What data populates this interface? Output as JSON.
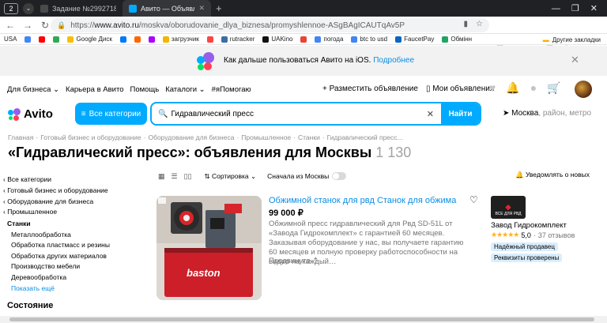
{
  "browser": {
    "tab_count": "2",
    "tabs": [
      {
        "title": "Задание №2992718 - про",
        "favicon_color": "#4a4a4a",
        "active": false
      },
      {
        "title": "Авито — Объявления на",
        "favicon_color": "#00aaff",
        "active": true
      }
    ],
    "address": {
      "prefix": "https://",
      "domain": "www.avito.ru",
      "path": "/moskva/oborudovanie_dlya_biznesa/promyshlennoe-ASgBAgICAUTqAv5P"
    },
    "bookmarks": [
      {
        "label": "USA",
        "color": "#ffffff"
      },
      {
        "label": "",
        "color": "#4285f4"
      },
      {
        "label": "",
        "color": "#ff0000"
      },
      {
        "label": "",
        "color": "#34a853"
      },
      {
        "label": "Google Диск",
        "color": "#fbbc05"
      },
      {
        "label": "",
        "color": "#0077ff"
      },
      {
        "label": "",
        "color": "#ff6600"
      },
      {
        "label": "",
        "color": "#aa00ff"
      },
      {
        "label": "загрузчик",
        "color": "#f4b400"
      },
      {
        "label": "",
        "color": "#ff4444"
      },
      {
        "label": "rutracker",
        "color": "#3a6ea5"
      },
      {
        "label": "UAKino",
        "color": "#111111"
      },
      {
        "label": "",
        "color": "#ea4335"
      },
      {
        "label": "погода",
        "color": "#4285f4"
      },
      {
        "label": "btc to usd",
        "color": "#4285f4"
      },
      {
        "label": "FaucetPay",
        "color": "#0b65c2"
      },
      {
        "label": "Обмінн",
        "color": "#21a366"
      }
    ],
    "other_bookmarks": "Другие закладки"
  },
  "banner": {
    "text": "Как дальше пользоваться Авито на iOS.",
    "link": "Подробнее"
  },
  "header": {
    "links": [
      "Для бизнеса ⌄",
      "Карьера в Авито",
      "Помощь",
      "Каталоги ⌄",
      "#яПомогаю"
    ],
    "post_ad": "+ Разместить объявление",
    "my_ads": "Мои объявления",
    "logo": "Avito",
    "categories_button": "Все категории",
    "search_value": "Гидравлический пресс",
    "find_button": "Найти",
    "location": "Москва",
    "location_hint": ", район, метро"
  },
  "breadcrumbs": [
    "Главная",
    "·",
    "Готовый бизнес и оборудование",
    "·",
    "Оборудование для бизнеса",
    "·",
    "Промышленное",
    "·",
    "Станки",
    "·",
    "Гидравлический пресс..."
  ],
  "page_title": "«Гидравлический пресс»: объявления для Москвы",
  "result_count": "1 130",
  "sidebar": {
    "back_links": [
      "Все категории",
      "Готовый бизнес и оборудование",
      "Оборудование для бизнеса",
      "Промышленное"
    ],
    "current": "Станки",
    "subcategories": [
      "Металлообработка",
      "Обработка пластмасс и резины",
      "Обработка других материалов",
      "Производство мебели",
      "Деревообработка"
    ],
    "show_more": "Показать ещё",
    "section_heading": "Состояние"
  },
  "toolbar": {
    "sort": "Сортировка",
    "moscow_first": "Сначала из Москвы",
    "notify": "Уведомлять о новых"
  },
  "listing": {
    "title": "Обжимной станок для рвд Станок для обжима",
    "price": "99 000 ₽",
    "description": "Обжимной пресс гидравлический для Рвд SD-51L от «Завода Гидрокомплект» с гарантией 60 месяцев. Заказывая оборудование у нас, вы получаете гарантию 60 месяцев и полную проверку работоспособности на видео на каждый…",
    "promo": "Продвинуто",
    "photo_caption": "baston",
    "seller": {
      "name": "Завод Гидрокомплект",
      "logo_text": "ВСЕ ДЛЯ РВД",
      "rating": "5,0",
      "reviews": "37 отзывов",
      "badges": [
        "Надёжный продавец",
        "Реквизиты проверены"
      ]
    }
  },
  "colors": {
    "accent": "#00aaff",
    "link": "#0a8ee4",
    "muted": "#8f8f8f",
    "star": "#ffb021"
  }
}
